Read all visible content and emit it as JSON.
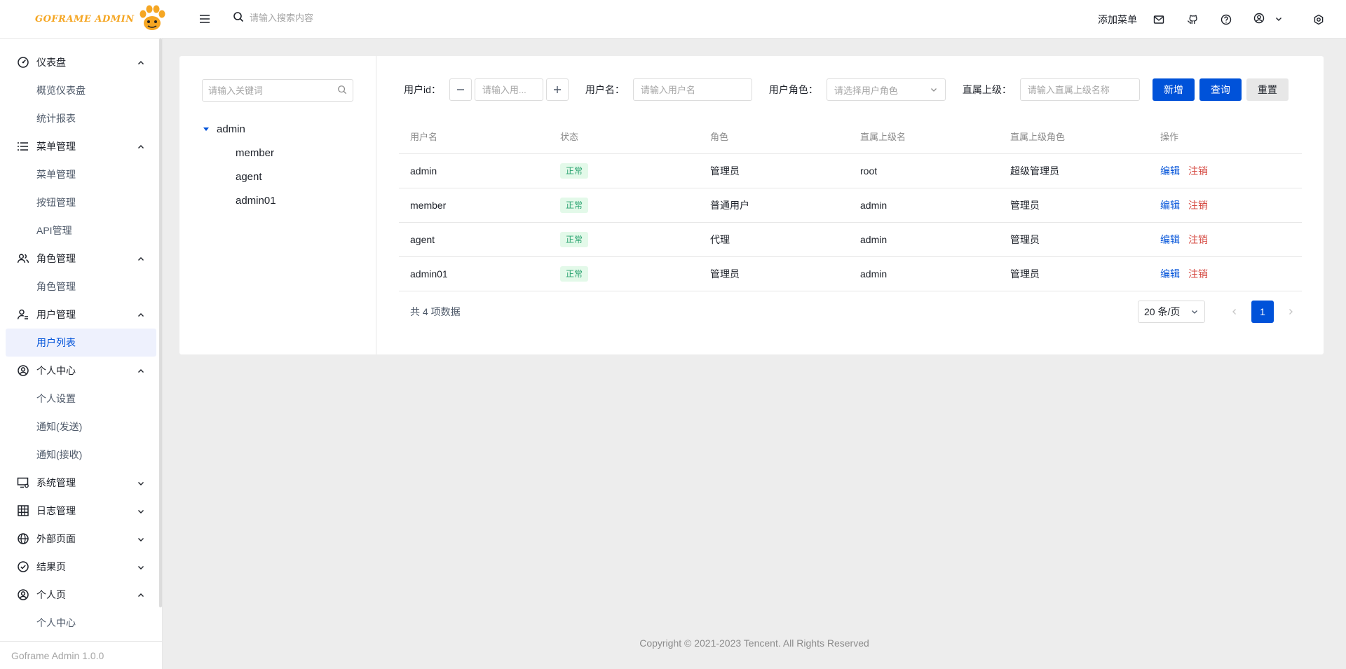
{
  "header": {
    "logo_text": "GOFRAME ADMIN",
    "search_placeholder": "请输入搜索内容",
    "add_menu_label": "添加菜单"
  },
  "sidebar": {
    "groups": [
      {
        "label": "仪表盘",
        "icon": "dashboard-icon",
        "expanded": true,
        "items": [
          "概览仪表盘",
          "统计报表"
        ]
      },
      {
        "label": "菜单管理",
        "icon": "list-icon",
        "expanded": true,
        "items": [
          "菜单管理",
          "按钮管理",
          "API管理"
        ]
      },
      {
        "label": "角色管理",
        "icon": "users-icon",
        "expanded": true,
        "items": [
          "角色管理"
        ]
      },
      {
        "label": "用户管理",
        "icon": "user-setting-icon",
        "expanded": true,
        "items": [
          "用户列表"
        ]
      },
      {
        "label": "个人中心",
        "icon": "user-circle-icon",
        "expanded": true,
        "items": [
          "个人设置",
          "通知(发送)",
          "通知(接收)"
        ]
      },
      {
        "label": "系统管理",
        "icon": "desktop-setting-icon",
        "expanded": false,
        "items": []
      },
      {
        "label": "日志管理",
        "icon": "table-icon",
        "expanded": false,
        "items": []
      },
      {
        "label": "外部页面",
        "icon": "globe-icon",
        "expanded": false,
        "items": []
      },
      {
        "label": "结果页",
        "icon": "check-circle-icon",
        "expanded": false,
        "items": []
      },
      {
        "label": "个人页",
        "icon": "user-circle-icon",
        "expanded": true,
        "items": [
          "个人中心"
        ]
      }
    ],
    "active_item": "用户列表",
    "footer": "Goframe Admin 1.0.0"
  },
  "tree": {
    "search_placeholder": "请输入关键词",
    "root": "admin",
    "children": [
      "member",
      "agent",
      "admin01"
    ]
  },
  "filters": {
    "user_id_label": "用户id：",
    "user_id_placeholder": "请输入用...",
    "username_label": "用户名：",
    "username_placeholder": "请输入用户名",
    "role_label": "用户角色：",
    "role_placeholder": "请选择用户角色",
    "superior_label": "直属上级：",
    "superior_placeholder": "请输入直属上级名称",
    "add_button": "新增",
    "query_button": "查询",
    "reset_button": "重置"
  },
  "table": {
    "columns": [
      "用户名",
      "状态",
      "角色",
      "直属上级名",
      "直属上级角色",
      "操作"
    ],
    "rows": [
      {
        "username": "admin",
        "status": "正常",
        "role": "管理员",
        "superior": "root",
        "superior_role": "超级管理员"
      },
      {
        "username": "member",
        "status": "正常",
        "role": "普通用户",
        "superior": "admin",
        "superior_role": "管理员"
      },
      {
        "username": "agent",
        "status": "正常",
        "role": "代理",
        "superior": "admin",
        "superior_role": "管理员"
      },
      {
        "username": "admin01",
        "status": "正常",
        "role": "管理员",
        "superior": "admin",
        "superior_role": "管理员"
      }
    ],
    "edit_label": "编辑",
    "delete_label": "注销"
  },
  "pagination": {
    "total_text": "共 4 项数据",
    "page_size": "20 条/页",
    "current_page": "1"
  },
  "footer": {
    "copyright": "Copyright © 2021-2023 Tencent. All Rights Reserved"
  },
  "colors": {
    "primary": "#0052d9",
    "danger": "#d54941",
    "success": "#2ba471",
    "logo": "#f5a623"
  }
}
